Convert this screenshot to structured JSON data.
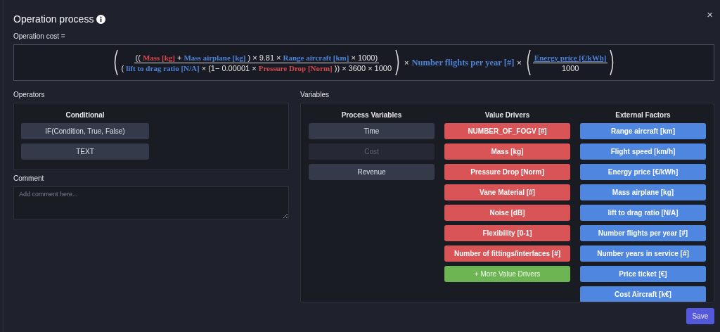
{
  "dialog": {
    "title": "Operation process",
    "close": "×"
  },
  "formula": {
    "label": "Operation cost =",
    "terms": [
      {
        "kind": "paren",
        "numerator": [
          {
            "kind": "sym",
            "text": "(("
          },
          {
            "kind": "driver",
            "text": "Mass [kg]"
          },
          {
            "kind": "sym",
            "text": "+"
          },
          {
            "kind": "factor",
            "text": "Mass airplane [kg]"
          },
          {
            "kind": "sym",
            "text": ") × 9.81 ×"
          },
          {
            "kind": "factor",
            "text": "Range aircraft [km]"
          },
          {
            "kind": "sym",
            "text": "× 1000)"
          }
        ],
        "denominator": [
          {
            "kind": "sym",
            "text": "("
          },
          {
            "kind": "factor",
            "text": "lift to drag ratio [N/A]"
          },
          {
            "kind": "sym",
            "text": "× (1− 0.00001 ×"
          },
          {
            "kind": "driver",
            "text": "Pressure Drop [Norm]"
          },
          {
            "kind": "sym",
            "text": ")) × 3600 × 1000"
          }
        ]
      },
      {
        "kind": "sym",
        "text": "×"
      },
      {
        "kind": "factor",
        "text": "Number flights per year [#]"
      },
      {
        "kind": "sym",
        "text": "×"
      },
      {
        "kind": "paren",
        "numerator": [
          {
            "kind": "factor",
            "text": "Energy price [€/kWh]"
          }
        ],
        "denominator": [
          {
            "kind": "sym",
            "text": "1000"
          }
        ]
      }
    ]
  },
  "operators": {
    "label": "Operators",
    "group_title": "Conditional",
    "items": [
      "IF(Condition, True, False)",
      "TEXT"
    ]
  },
  "comment": {
    "label": "Comment",
    "placeholder": "Add comment here..."
  },
  "variables": {
    "label": "Variables",
    "process": {
      "title": "Process Variables",
      "items": [
        {
          "label": "Time",
          "disabled": false
        },
        {
          "label": "Cost",
          "disabled": true
        },
        {
          "label": "Revenue",
          "disabled": false
        }
      ]
    },
    "drivers": {
      "title": "Value Drivers",
      "items": [
        "NUMBER_OF_FOGV [#]",
        "Mass [kg]",
        "Pressure Drop [Norm]",
        "Vane Material [#]",
        "Noise [dB]",
        "Flexibility [0-1]",
        "Number of fittings/interfaces [#]"
      ],
      "more": "+ More Value Drivers"
    },
    "factors": {
      "title": "External Factors",
      "items": [
        "Range aircraft [km]",
        "Flight speed [km/h]",
        "Energy price [€/kWh]",
        "Mass airplane [kg]",
        "lift to drag ratio [N/A]",
        "Number flights per year [#]",
        "Number years in service [#]",
        "Price ticket [€]",
        "Cost Aircraft [k€]"
      ]
    }
  },
  "save": "Save"
}
